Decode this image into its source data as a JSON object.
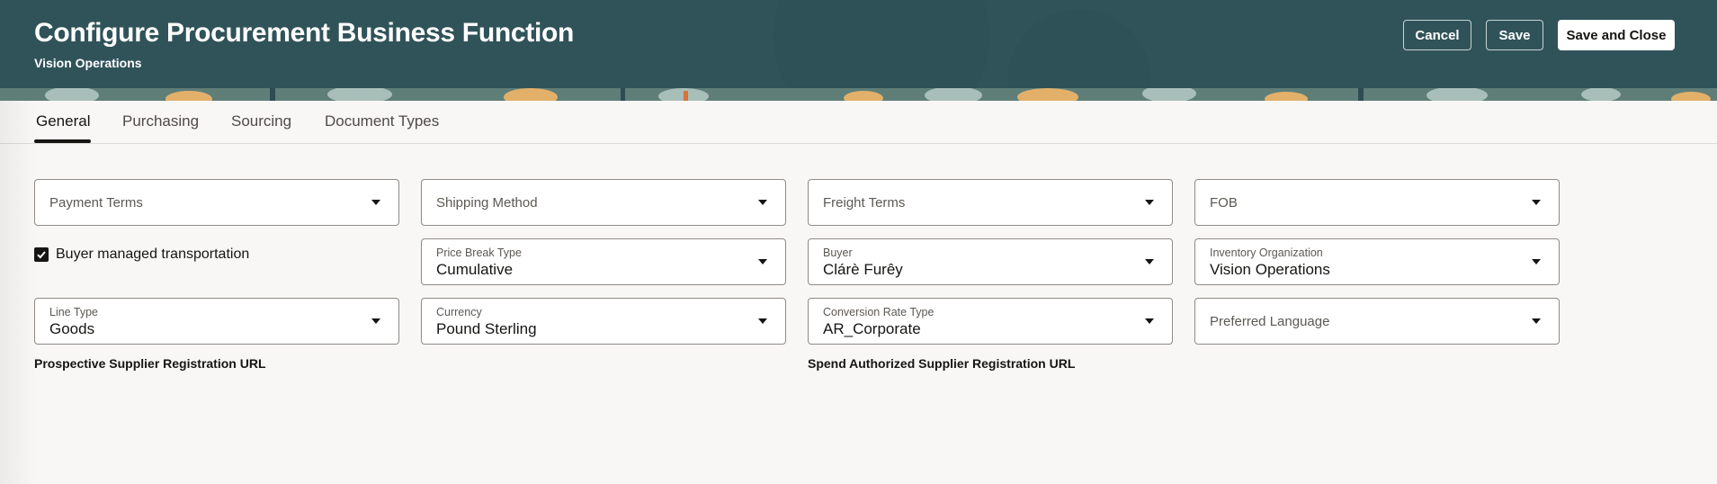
{
  "header": {
    "title": "Configure Procurement Business Function",
    "subtitle": "Vision Operations",
    "cancel_label": "Cancel",
    "save_label": "Save",
    "save_close_label": "Save and Close",
    "background_color": "#30535a"
  },
  "tabs": [
    {
      "label": "General",
      "active": true
    },
    {
      "label": "Purchasing",
      "active": false
    },
    {
      "label": "Sourcing",
      "active": false
    },
    {
      "label": "Document Types",
      "active": false
    }
  ],
  "fields": {
    "payment_terms": {
      "placeholder": "Payment Terms"
    },
    "shipping_method": {
      "placeholder": "Shipping Method"
    },
    "freight_terms": {
      "placeholder": "Freight Terms"
    },
    "fob": {
      "placeholder": "FOB"
    },
    "price_break_type": {
      "label": "Price Break Type",
      "value": "Cumulative"
    },
    "buyer": {
      "label": "Buyer",
      "value": "Clárè Furêy"
    },
    "inventory_organization": {
      "label": "Inventory Organization",
      "value": "Vision Operations"
    },
    "line_type": {
      "label": "Line Type",
      "value": "Goods"
    },
    "currency": {
      "label": "Currency",
      "value": "Pound Sterling"
    },
    "conversion_rate_type": {
      "label": "Conversion Rate Type",
      "value": "AR_Corporate"
    },
    "preferred_language": {
      "placeholder": "Preferred Language"
    }
  },
  "buyer_managed_transportation": {
    "label": "Buyer managed transportation",
    "checked": true
  },
  "prospective_supplier_url_label": "Prospective Supplier Registration URL",
  "spend_authorized_supplier_url_label": "Spend Authorized Supplier Registration URL"
}
